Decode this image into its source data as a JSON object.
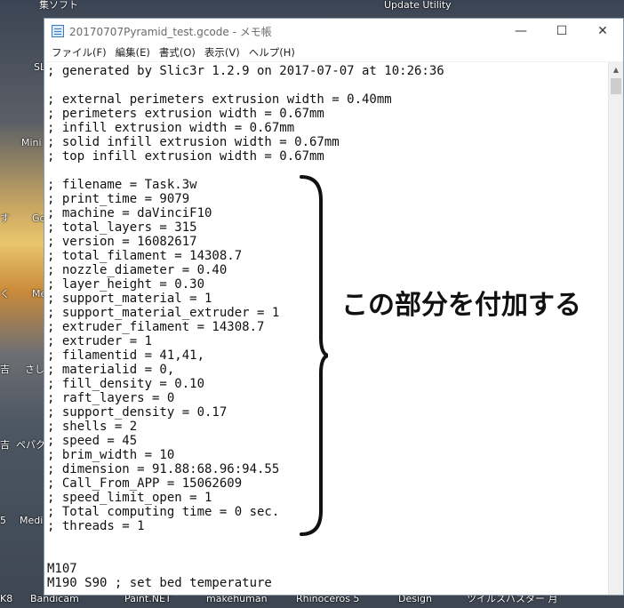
{
  "desktop": {
    "top_labels": [
      "集ソフト",
      "Update Utility"
    ],
    "left_labels": [
      "SL",
      "Mini",
      "す",
      "Go",
      "く",
      "Me",
      "吉",
      "さし",
      "吉",
      "ペパク",
      "5",
      "Medi"
    ],
    "bottom_labels": [
      "K8",
      "Bandicam",
      "Paint.NET",
      "makehuman",
      "Rhinoceros 5",
      "Design",
      "ツイルスバスター 月"
    ]
  },
  "window": {
    "title": "20170707Pyramid_test.gcode - メモ帳",
    "controls": {
      "minimize": "—",
      "maximize": "☐",
      "close": "✕"
    }
  },
  "menu": [
    "ファイル(F)",
    "編集(E)",
    "書式(O)",
    "表示(V)",
    "ヘルプ(H)"
  ],
  "editor": {
    "lines": [
      "; generated by Slic3r 1.2.9 on 2017-07-07 at 10:26:36",
      "",
      "; external perimeters extrusion width = 0.40mm",
      "; perimeters extrusion width = 0.67mm",
      "; infill extrusion width = 0.67mm",
      "; solid infill extrusion width = 0.67mm",
      "; top infill extrusion width = 0.67mm",
      "",
      "; filename = Task.3w",
      "; print_time = 9079",
      "; machine = daVinciF10",
      "; total_layers = 315",
      "; version = 16082617",
      "; total_filament = 14308.7",
      "; nozzle_diameter = 0.40",
      "; layer_height = 0.30",
      "; support_material = 1",
      "; support_material_extruder = 1",
      "; extruder_filament = 14308.7",
      "; extruder = 1",
      "; filamentid = 41,41,",
      "; materialid = 0,",
      "; fill_density = 0.10",
      "; raft_layers = 0",
      "; support_density = 0.17",
      "; shells = 2",
      "; speed = 45",
      "; brim_width = 10",
      "; dimension = 91.88:68.96:94.55",
      "; Call_From_APP = 15062609",
      "; speed_limit_open = 1",
      "; Total computing time = 0 sec.",
      "; threads = 1",
      "",
      "",
      "M107",
      "M190 S90 ; set bed temperature"
    ]
  },
  "annotation": {
    "text": "この部分を付加する"
  }
}
